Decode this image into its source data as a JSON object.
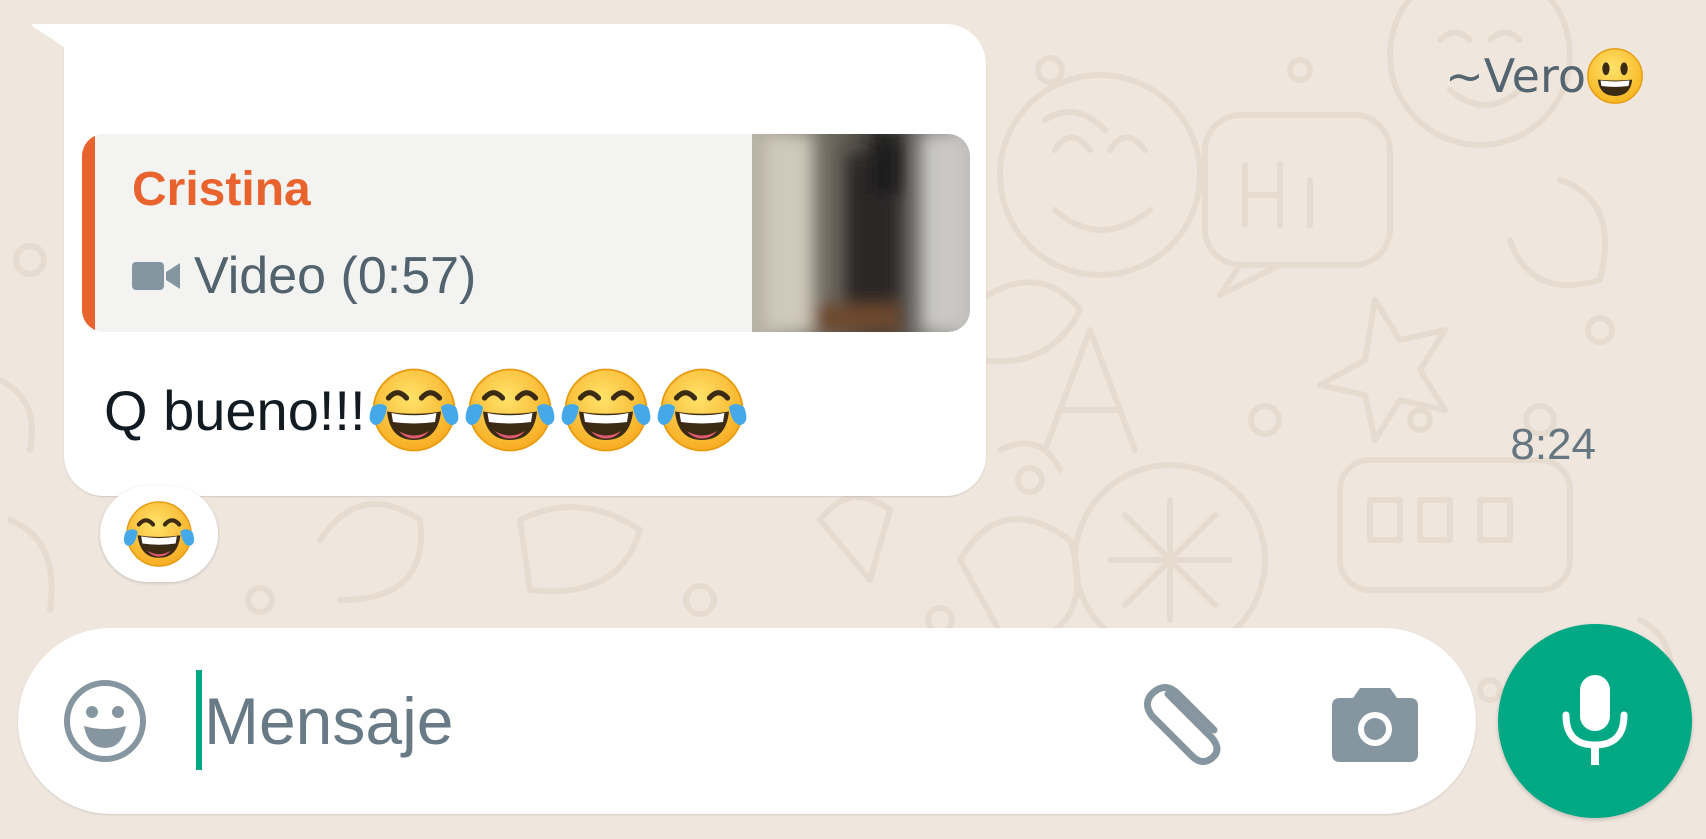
{
  "colors": {
    "background": "#efe7de",
    "bubble": "#ffffff",
    "quote_accent": "#e8632d",
    "quote_background": "#f3f4f2",
    "muted_text": "#54656f",
    "primary_text": "#111b21",
    "accent_green": "#00a884"
  },
  "message": {
    "sender": "~Vero",
    "sender_emoji": "grinning-face-emoji",
    "quoted": {
      "author": "Cristina",
      "media_icon": "video-camera-icon",
      "media_label": "Video (0:57)",
      "thumbnail": "video-thumbnail"
    },
    "text": "Q bueno!!!",
    "text_emojis": [
      "face-with-tears-of-joy-emoji",
      "face-with-tears-of-joy-emoji",
      "face-with-tears-of-joy-emoji",
      "face-with-tears-of-joy-emoji"
    ],
    "time": "8:24",
    "reaction": "face-with-tears-of-joy-emoji"
  },
  "composer": {
    "placeholder": "Mensaje",
    "value": "",
    "emoji_button_icon": "smiley-icon",
    "attach_icon": "paperclip-icon",
    "camera_icon": "camera-icon",
    "mic_icon": "microphone-icon"
  }
}
